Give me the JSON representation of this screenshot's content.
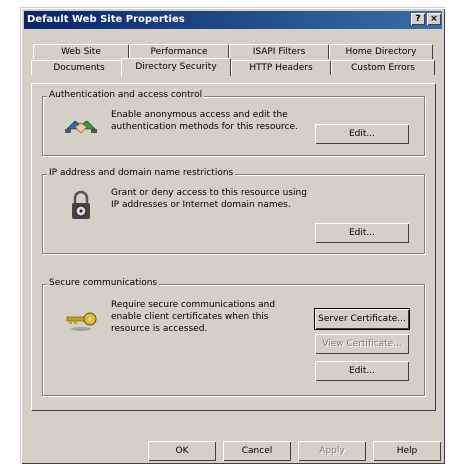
{
  "window": {
    "title": "Default Web Site Properties"
  },
  "title_buttons": {
    "help": "?",
    "close": "×"
  },
  "tabs_row1": [
    "Web Site",
    "Performance",
    "ISAPI Filters",
    "Home Directory"
  ],
  "tabs_row2": [
    "Documents",
    "Directory Security",
    "HTTP Headers",
    "Custom Errors"
  ],
  "active_tab": "Directory Security",
  "auth": {
    "legend": "Authentication and access control",
    "line1": "Enable anonymous access and edit the",
    "line2": "authentication methods for this resource.",
    "edit": "Edit..."
  },
  "ip": {
    "legend": "IP address and domain name restrictions",
    "line1": "Grant or deny access to this resource using",
    "line2": "IP addresses or Internet domain names.",
    "edit": "Edit..."
  },
  "secure": {
    "legend": "Secure communications",
    "line1": "Require secure communications and",
    "line2": "enable client certificates when this",
    "line3": "resource is accessed.",
    "server_cert": "Server Certificate...",
    "view_cert": "View Certificate...",
    "edit": "Edit..."
  },
  "footer": {
    "ok": "OK",
    "cancel": "Cancel",
    "apply": "Apply",
    "help": "Help"
  }
}
